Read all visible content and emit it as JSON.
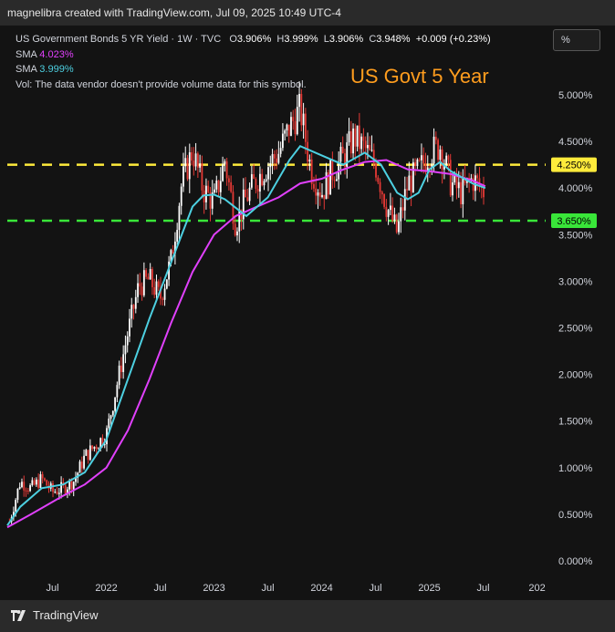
{
  "header": {
    "attribution": "magnelibra created with TradingView.com, Jul 09, 2025 10:49 UTC-4"
  },
  "legend": {
    "symbol": "US Government Bonds 5 YR Yield · 1W · TVC",
    "o_label": "O",
    "o_value": "3.906%",
    "h_label": "H",
    "h_value": "3.999%",
    "l_label": "L",
    "l_value": "3.906%",
    "c_label": "C",
    "c_value": "3.948%",
    "change": "+0.009 (+0.23%)",
    "sma1_label": "SMA",
    "sma1_value": "4.023%",
    "sma2_label": "SMA",
    "sma2_value": "3.999%",
    "vol_note": "Vol: The data vendor doesn't provide volume data for this symbol."
  },
  "annotation_title": "US Govt 5 Year",
  "scale_button": "%",
  "footer": {
    "brand": "TradingView"
  },
  "colors": {
    "up": "#ffffff",
    "down": "#e53935",
    "sma_slow": "#e040fb",
    "sma_fast": "#4dd0e1",
    "line_resistance": "#ffeb3b",
    "line_support": "#39e639",
    "title": "#ff9d1e"
  },
  "chart_data": {
    "type": "candlestick",
    "title": "US Govt 5 Year",
    "y_unit": "%",
    "ylim": [
      -0.1,
      5.1
    ],
    "y_ticks": [
      "5.000%",
      "4.500%",
      "4.000%",
      "3.500%",
      "3.000%",
      "2.500%",
      "2.000%",
      "1.500%",
      "1.000%",
      "0.500%",
      "0.000%"
    ],
    "x_ticks": [
      "Jul",
      "2022",
      "Jul",
      "2023",
      "Jul",
      "2024",
      "Jul",
      "2025",
      "Jul",
      "202"
    ],
    "x_range_years": [
      2021.08,
      2026.08
    ],
    "horizontal_lines": [
      {
        "value": 4.25,
        "label": "4.250%",
        "color": "#ffeb3b"
      },
      {
        "value": 3.65,
        "label": "3.650%",
        "color": "#39e639"
      }
    ],
    "series": [
      {
        "name": "US Government Bonds 5 YR Yield",
        "kind": "weekly closes (approx.)",
        "anchors": [
          [
            2021.1,
            0.42
          ],
          [
            2021.2,
            0.85
          ],
          [
            2021.3,
            0.78
          ],
          [
            2021.4,
            0.88
          ],
          [
            2021.5,
            0.74
          ],
          [
            2021.6,
            0.78
          ],
          [
            2021.7,
            0.86
          ],
          [
            2021.8,
            1.12
          ],
          [
            2021.9,
            1.24
          ],
          [
            2022.0,
            1.36
          ],
          [
            2022.1,
            1.9
          ],
          [
            2022.2,
            2.45
          ],
          [
            2022.3,
            2.95
          ],
          [
            2022.4,
            3.02
          ],
          [
            2022.5,
            2.82
          ],
          [
            2022.6,
            3.22
          ],
          [
            2022.7,
            4.05
          ],
          [
            2022.8,
            4.4
          ],
          [
            2022.9,
            3.98
          ],
          [
            2023.0,
            3.85
          ],
          [
            2023.1,
            4.3
          ],
          [
            2023.2,
            3.62
          ],
          [
            2023.3,
            3.9
          ],
          [
            2023.4,
            4.1
          ],
          [
            2023.5,
            4.25
          ],
          [
            2023.6,
            4.38
          ],
          [
            2023.7,
            4.65
          ],
          [
            2023.8,
            4.85
          ],
          [
            2023.9,
            4.2
          ],
          [
            2024.0,
            3.95
          ],
          [
            2024.1,
            4.18
          ],
          [
            2024.2,
            4.32
          ],
          [
            2024.3,
            4.55
          ],
          [
            2024.4,
            4.42
          ],
          [
            2024.5,
            4.25
          ],
          [
            2024.6,
            3.82
          ],
          [
            2024.7,
            3.52
          ],
          [
            2024.8,
            4.05
          ],
          [
            2024.9,
            4.18
          ],
          [
            2025.0,
            4.38
          ],
          [
            2025.1,
            4.45
          ],
          [
            2025.2,
            4.05
          ],
          [
            2025.3,
            3.95
          ],
          [
            2025.4,
            4.1
          ],
          [
            2025.52,
            3.95
          ]
        ]
      },
      {
        "name": "SMA",
        "value": "4.023%",
        "color": "#e040fb",
        "points": [
          [
            2021.08,
            0.36
          ],
          [
            2021.3,
            0.5
          ],
          [
            2021.6,
            0.7
          ],
          [
            2021.8,
            0.82
          ],
          [
            2022.0,
            1.0
          ],
          [
            2022.2,
            1.4
          ],
          [
            2022.4,
            1.95
          ],
          [
            2022.6,
            2.55
          ],
          [
            2022.8,
            3.1
          ],
          [
            2023.0,
            3.5
          ],
          [
            2023.2,
            3.7
          ],
          [
            2023.4,
            3.8
          ],
          [
            2023.6,
            3.9
          ],
          [
            2023.8,
            4.05
          ],
          [
            2024.0,
            4.1
          ],
          [
            2024.2,
            4.2
          ],
          [
            2024.4,
            4.28
          ],
          [
            2024.6,
            4.3
          ],
          [
            2024.8,
            4.2
          ],
          [
            2025.0,
            4.18
          ],
          [
            2025.2,
            4.15
          ],
          [
            2025.4,
            4.08
          ],
          [
            2025.52,
            4.02
          ]
        ]
      },
      {
        "name": "SMA",
        "value": "3.999%",
        "color": "#4dd0e1",
        "points": [
          [
            2021.08,
            0.38
          ],
          [
            2021.2,
            0.58
          ],
          [
            2021.4,
            0.78
          ],
          [
            2021.6,
            0.82
          ],
          [
            2021.8,
            0.95
          ],
          [
            2022.0,
            1.3
          ],
          [
            2022.2,
            1.95
          ],
          [
            2022.4,
            2.6
          ],
          [
            2022.6,
            3.2
          ],
          [
            2022.8,
            3.8
          ],
          [
            2022.9,
            3.92
          ],
          [
            2023.0,
            3.93
          ],
          [
            2023.1,
            3.88
          ],
          [
            2023.3,
            3.7
          ],
          [
            2023.5,
            3.9
          ],
          [
            2023.7,
            4.3
          ],
          [
            2023.8,
            4.45
          ],
          [
            2024.0,
            4.35
          ],
          [
            2024.2,
            4.25
          ],
          [
            2024.4,
            4.38
          ],
          [
            2024.55,
            4.25
          ],
          [
            2024.7,
            3.95
          ],
          [
            2024.8,
            3.88
          ],
          [
            2024.9,
            3.95
          ],
          [
            2025.0,
            4.2
          ],
          [
            2025.1,
            4.28
          ],
          [
            2025.2,
            4.18
          ],
          [
            2025.4,
            4.05
          ],
          [
            2025.52,
            4.0
          ]
        ]
      }
    ]
  }
}
